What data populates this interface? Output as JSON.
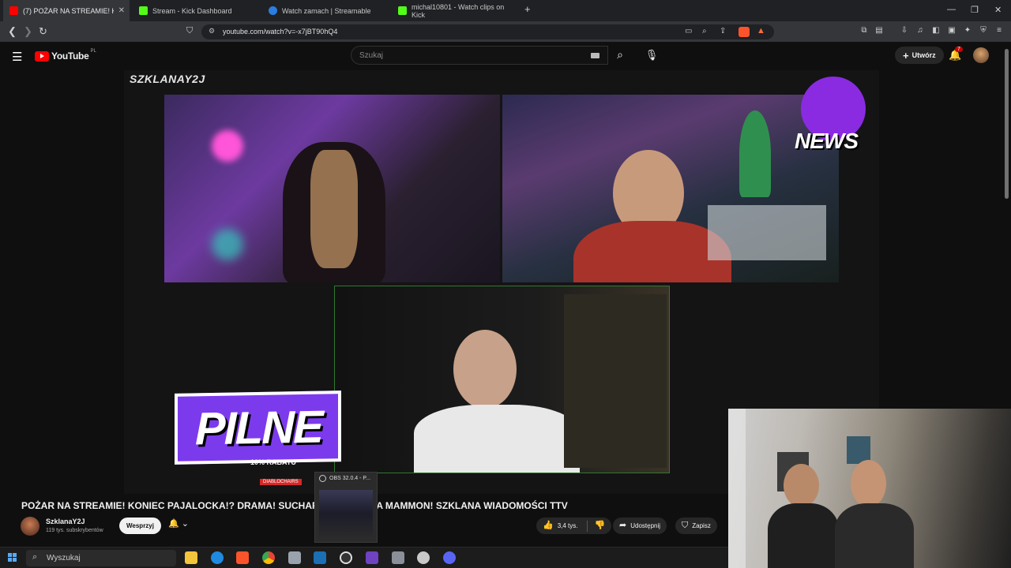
{
  "browser": {
    "tabs": [
      {
        "label": "(7) POŻAR NA STREAMIE! KO",
        "active": true,
        "favicon_color": "#ff0000"
      },
      {
        "label": "Stream - Kick Dashboard",
        "active": false,
        "favicon_color": "#53fc18"
      },
      {
        "label": "Watch zamach | Streamable",
        "active": false,
        "favicon_color": "#2a7de1"
      },
      {
        "label": "michal10801 - Watch clips on Kick",
        "active": false,
        "favicon_color": "#53fc18"
      }
    ],
    "new_tab": "+",
    "url": "youtube.com/watch?v=-x7jBT90hQ4"
  },
  "youtube": {
    "logo_text": "YouTube",
    "logo_region": "PL",
    "search_placeholder": "Szukaj",
    "create_label": "Utwórz",
    "notification_count": "7"
  },
  "video": {
    "channel_watermark": "SZKLANAY2J",
    "news_logo_text": "NEWS",
    "pilne_text": "PILNE",
    "promo_text": "10% RABATU",
    "promo_brand": "DIABLOCHAIRS"
  },
  "video_info": {
    "title": "POŻAR NA STREAMIE! KONIEC PAJALOCKA!? DRAMA! SUCHAR! KASTRACJA MAMMON! SZKLANA WIADOMOŚCI TTV",
    "channel_name": "SzklanaY2J",
    "subscribers": "119 tys. subskrybentów",
    "support_label": "Wesprzyj",
    "likes": "3,4 tys.",
    "share_label": "Udostępnij",
    "save_label": "Zapisz"
  },
  "obs_popup": {
    "title": "OBS 32.0.4 - P..."
  },
  "taskbar": {
    "search_placeholder": "Wyszukaj"
  },
  "colors": {
    "youtube_red": "#ff0000",
    "kick_green": "#53fc18",
    "pilne_purple": "#7c3aed",
    "news_purple": "#8a2be2"
  }
}
